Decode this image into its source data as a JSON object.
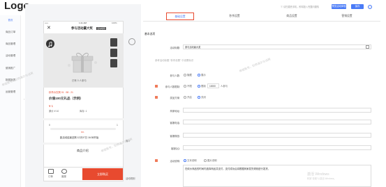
{
  "app": {
    "logo": "Logo"
  },
  "header": {
    "hint": "① 请扫描完手机，即将投入完整问题情",
    "preview_btn": "预览活动体验",
    "save_btn": "保存"
  },
  "nav": {
    "items": [
      "首页",
      "商品订单",
      "商品管理",
      "活动管理",
      "营销推广",
      "数据报表",
      "运营管理"
    ]
  },
  "phone": {
    "status_left": "•••••",
    "status_time": "1:21 AM",
    "status_right": "100%",
    "close": "✕",
    "title": "参与活动赢大奖",
    "title_badge": "活动规则",
    "banner_caption": "已有 0 人参与",
    "price_badge": "秒杀价仅剩 01 : 58 : 21",
    "prize_title": "价值100元礼品（示例）",
    "price": "¥ 1",
    "original_price": "原价 ¥ 10",
    "stock": "库存: 1",
    "progress_left": "0",
    "progress_right": "1",
    "progress_sub": "0%",
    "deadline": "距活动结束还剩 12天07日 16:38开始",
    "detail_title": "商品介绍",
    "bottom_left": "订单",
    "bottom_mid": "客服",
    "cart": "立即购买",
    "side_label_1": "简介",
    "side_label_2": "活动规则"
  },
  "tabs": [
    "基础设置",
    "秒杀设置",
    "商品设置",
    "营销设置"
  ],
  "form": {
    "section": "基本选项",
    "title_label": "活动标题:",
    "title_value": "参与活动赢大奖",
    "title_hint": "参考活动标题 \"秒杀设置\" 中设置标识",
    "join_label": "参与人数:",
    "join_opt1": "隐藏",
    "join_opt2": "展示",
    "limit_label": "参与人数限制:",
    "limit_opt1": "不限",
    "limit_opt2": "限制",
    "limit_value": "10000",
    "limit_unit": "人参与",
    "reward_label": "奖品方案:",
    "reward_opt1": "开启",
    "reward_opt2": "关闭",
    "merchant_label": "商家地址:",
    "phone_label": "客服电话:",
    "wechat_label": "客服微信:",
    "qq_label": "客服QQ:",
    "desc_label": "活动说明:",
    "desc_opt1": "文本说明",
    "desc_opt2": "图片说明",
    "desc_text": "在砍价商品的时间内选择商品并支付，支付成功后将根据商家发货规则进行发货。",
    "windows_line1": "激活 Windows",
    "windows_line2": "转到\"设置\"以激活 Windows。"
  },
  "watermarks": [
    "体验账号，仅供演示与试用",
    "体验账号，仅供演示与试用",
    "体验账号，仅供演示与试用"
  ],
  "colors": {
    "accent": "#4a7bf7",
    "danger": "#e84a2f"
  }
}
